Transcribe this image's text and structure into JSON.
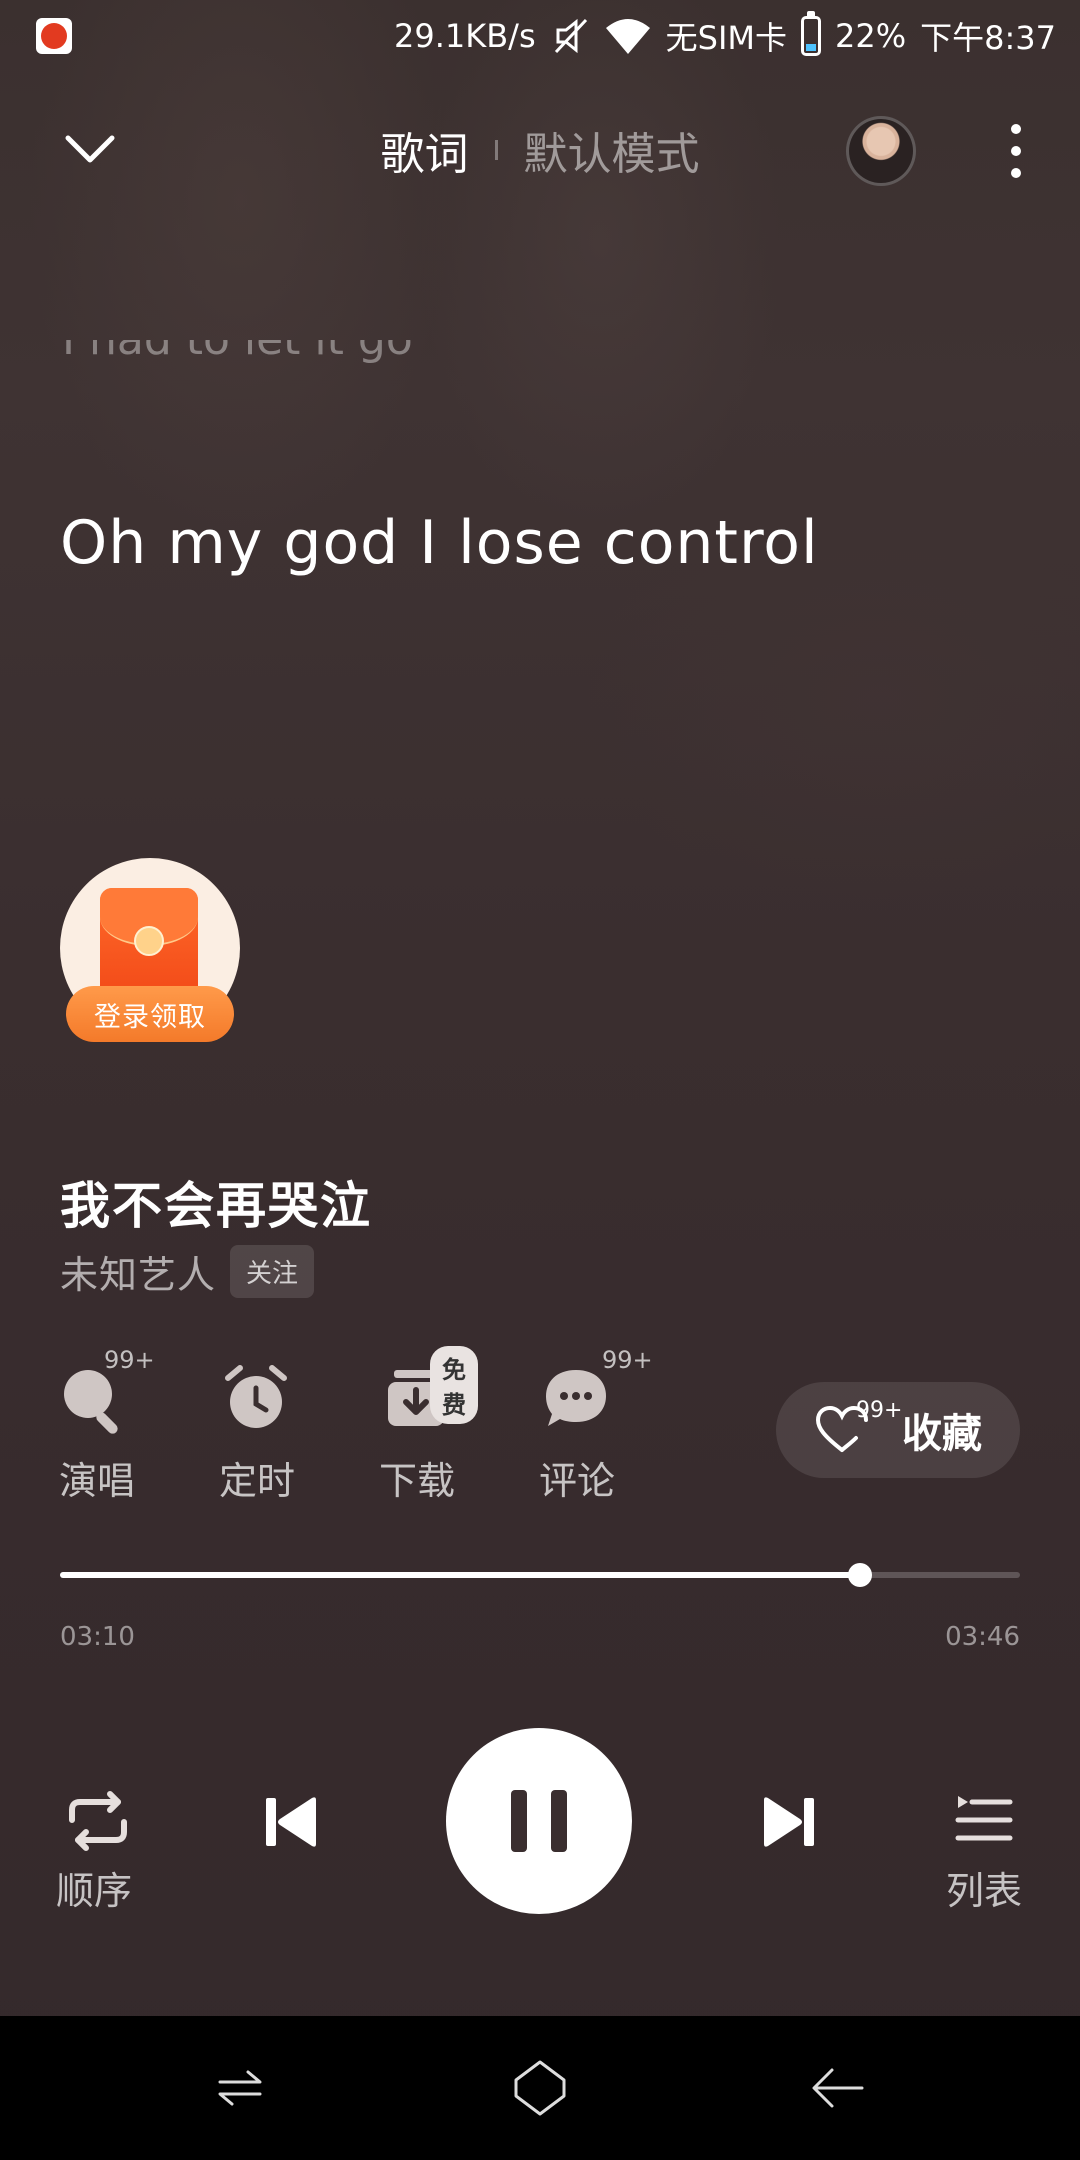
{
  "status_bar": {
    "net_speed": "29.1KB/s",
    "sim_status": "无SIM卡",
    "battery_percent": "22%",
    "time": "下午8:37",
    "battery_level": 0.22,
    "icons": [
      "app-notification-icon",
      "mute-icon",
      "wifi-icon",
      "battery-icon"
    ]
  },
  "header": {
    "tabs": [
      {
        "label": "歌词",
        "active": true
      },
      {
        "label": "默认模式",
        "active": false
      }
    ],
    "icons": [
      "chevron-down-icon",
      "avatar",
      "more-vertical-icon"
    ]
  },
  "lyrics": {
    "previous_line": "I had to let it go",
    "current_line": "Oh my god I lose control"
  },
  "promo": {
    "label": "登录领取",
    "icon": "red-packet-icon"
  },
  "song": {
    "title": "我不会再哭泣",
    "artist": "未知艺人",
    "follow_label": "关注"
  },
  "actions": [
    {
      "label": "演唱",
      "badge": "99+",
      "icon": "sing-mic-icon"
    },
    {
      "label": "定时",
      "badge": "",
      "icon": "alarm-clock-icon"
    },
    {
      "label": "下载",
      "badge": "免费",
      "icon": "download-icon"
    },
    {
      "label": "评论",
      "badge": "99+",
      "icon": "comment-icon"
    }
  ],
  "favorite": {
    "count": "99+",
    "label": "收藏",
    "icon": "heart-icon"
  },
  "progress": {
    "current_time": "03:10",
    "total_time": "03:46",
    "fraction": 0.833
  },
  "controls": {
    "repeat_label": "顺序",
    "playlist_label": "列表",
    "state": "playing",
    "icons": [
      "repeat-icon",
      "previous-icon",
      "pause-icon",
      "next-icon",
      "playlist-icon"
    ]
  },
  "colors": {
    "background": "#3a2e2f",
    "accent": "#f47a2a",
    "text": "#ffffff"
  }
}
